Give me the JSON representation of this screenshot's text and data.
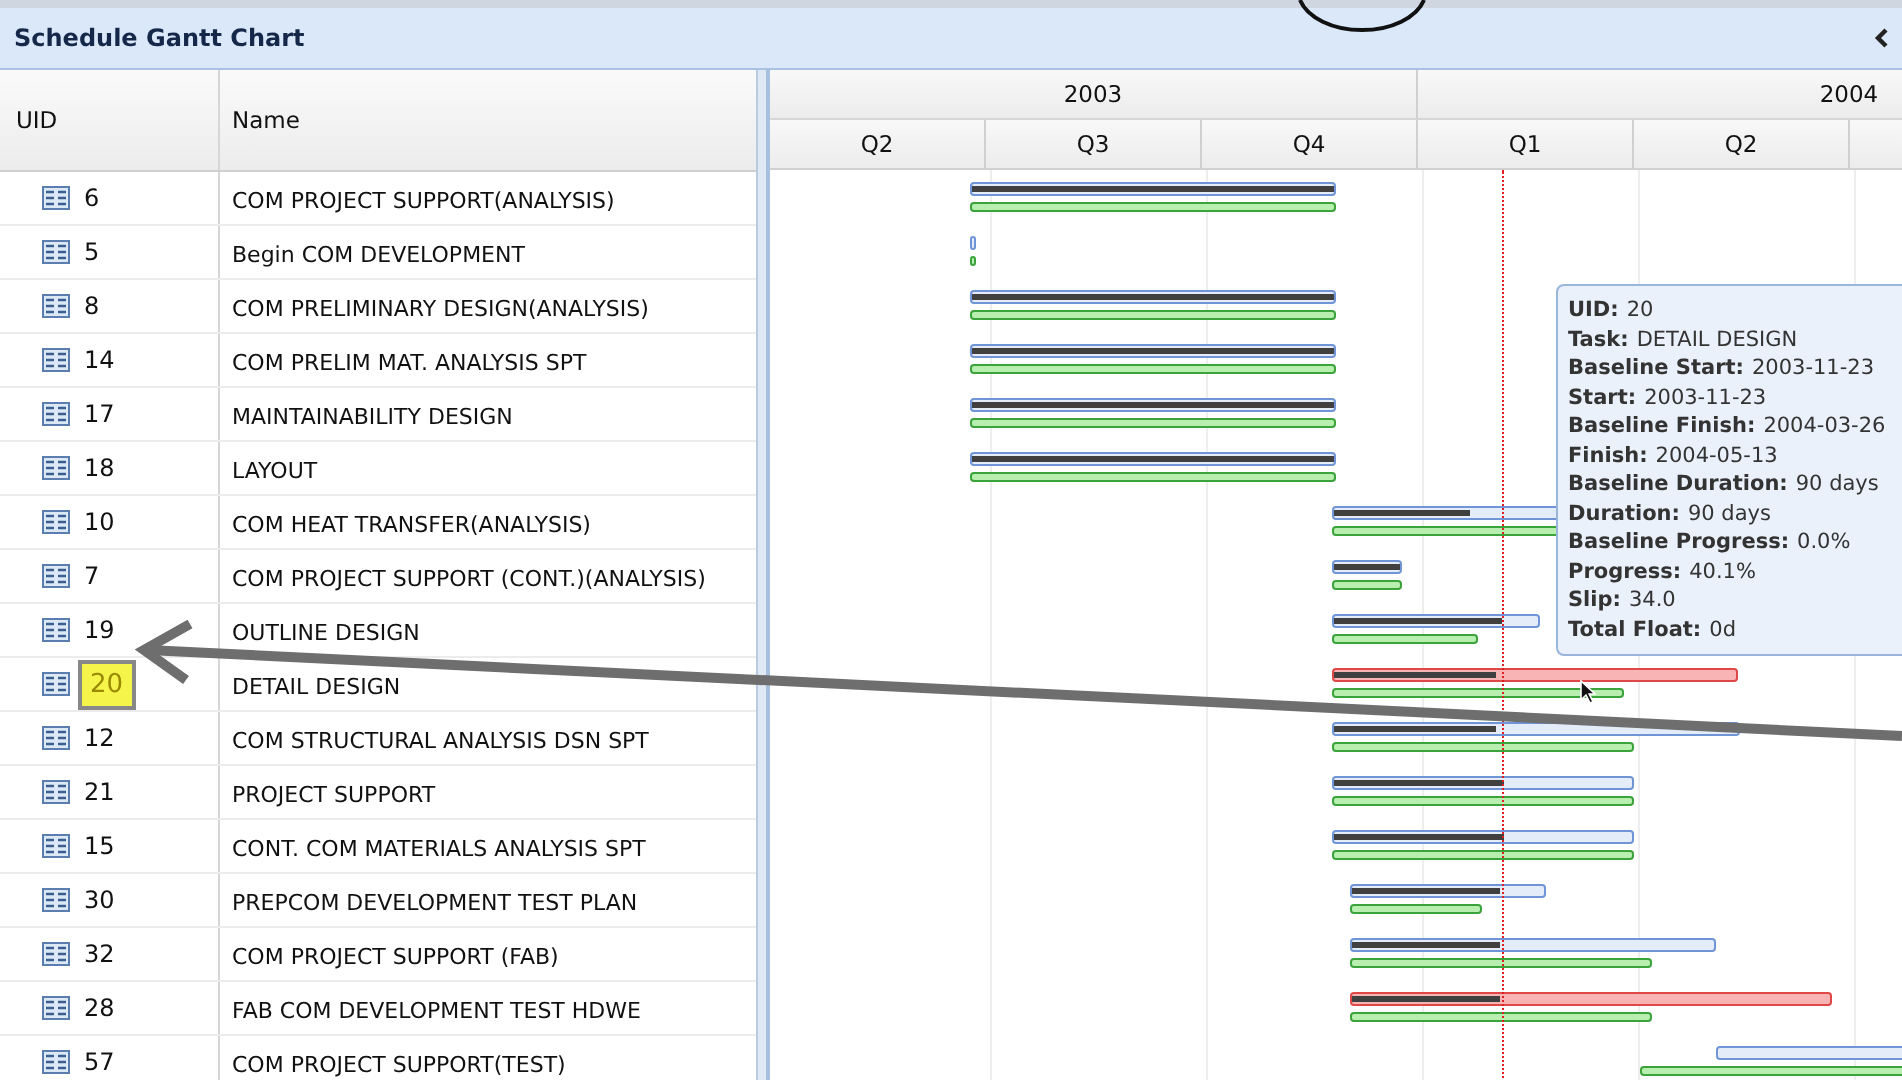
{
  "panel": {
    "title": "Schedule Gantt Chart"
  },
  "columns": [
    "UID",
    "Name"
  ],
  "timescale": {
    "years": [
      {
        "label": "2003",
        "quarters": [
          "Q2",
          "Q3",
          "Q4"
        ]
      },
      {
        "label": "2004",
        "quarters": [
          "Q1",
          "Q2"
        ]
      }
    ]
  },
  "rows": [
    {
      "uid": "6",
      "name": "COM PROJECT SUPPORT(ANALYSIS)",
      "highlighted": false,
      "bar": {
        "level": 1,
        "critical": false
      }
    },
    {
      "uid": "5",
      "name": "Begin COM DEVELOPMENT",
      "highlighted": false,
      "bar": {
        "critical": false
      }
    },
    {
      "uid": "8",
      "name": "COM PRELIMINARY DESIGN(ANALYSIS)",
      "highlighted": false,
      "bar": {
        "level": 1,
        "critical": false
      }
    },
    {
      "uid": "14",
      "name": "COM PRELIM MAT. ANALYSIS SPT",
      "highlighted": false,
      "bar": {
        "level": 1,
        "critical": false
      }
    },
    {
      "uid": "17",
      "name": "MAINTAINABILITY DESIGN",
      "highlighted": false,
      "bar": {
        "level": 1,
        "critical": false
      }
    },
    {
      "uid": "18",
      "name": "LAYOUT",
      "highlighted": false,
      "bar": {
        "level": 1,
        "critical": false
      }
    },
    {
      "uid": "10",
      "name": "COM HEAT TRANSFER(ANALYSIS)",
      "highlighted": false,
      "bar": {
        "level": 0.45,
        "critical": false
      }
    },
    {
      "uid": "7",
      "name": "COM PROJECT SUPPORT (CONT.)(ANALYSIS)",
      "highlighted": false,
      "bar": {
        "level": 1,
        "critical": false
      }
    },
    {
      "uid": "19",
      "name": "OUTLINE DESIGN",
      "highlighted": false,
      "bar": {
        "level": 0.82,
        "critical": false
      }
    },
    {
      "uid": "20",
      "name": "DETAIL DESIGN",
      "highlighted": true,
      "bar": {
        "level": 0.401,
        "critical": true
      }
    },
    {
      "uid": "12",
      "name": "COM STRUCTURAL ANALYSIS DSN SPT",
      "highlighted": false,
      "bar": {
        "level": 0.4,
        "critical": false
      }
    },
    {
      "uid": "21",
      "name": "PROJECT SUPPORT",
      "highlighted": false,
      "bar": {
        "level": 0.57,
        "critical": false
      }
    },
    {
      "uid": "15",
      "name": "CONT. COM MATERIALS ANALYSIS SPT",
      "highlighted": false,
      "bar": {
        "level": 0.57,
        "critical": false
      }
    },
    {
      "uid": "30",
      "name": "PREPCOM DEVELOPMENT TEST PLAN",
      "highlighted": false,
      "bar": {
        "level": 0.77,
        "critical": false
      }
    },
    {
      "uid": "32",
      "name": "COM PROJECT SUPPORT (FAB)",
      "highlighted": false,
      "bar": {
        "level": 0.41,
        "critical": false
      }
    },
    {
      "uid": "28",
      "name": "FAB COM DEVELOPMENT TEST HDWE",
      "highlighted": false,
      "bar": {
        "level": 0.31,
        "critical": true
      }
    },
    {
      "uid": "57",
      "name": "COM PROJECT SUPPORT(TEST)",
      "highlighted": false,
      "bar": {
        "critical": false
      }
    }
  ],
  "tooltip": {
    "fields": [
      {
        "label": "UID:",
        "value": "20"
      },
      {
        "label": "Task:",
        "value": "DETAIL DESIGN"
      },
      {
        "label": "Baseline Start:",
        "value": "2003-11-23"
      },
      {
        "label": "Start:",
        "value": "2003-11-23"
      },
      {
        "label": "Baseline Finish:",
        "value": "2004-03-26"
      },
      {
        "label": "Finish:",
        "value": "2004-05-13"
      },
      {
        "label": "Baseline Duration:",
        "value": "90 days"
      },
      {
        "label": "Duration:",
        "value": "90 days"
      },
      {
        "label": "Baseline Progress:",
        "value": "0.0%"
      },
      {
        "label": "Progress:",
        "value": "40.1%"
      },
      {
        "label": "Slip:",
        "value": "34.0"
      },
      {
        "label": "Total Float:",
        "value": "0d"
      }
    ]
  }
}
